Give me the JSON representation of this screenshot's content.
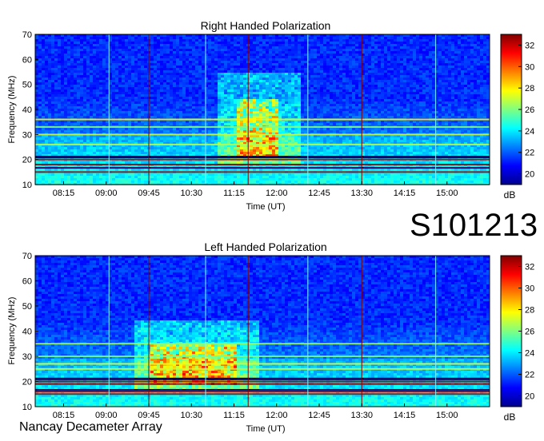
{
  "colors": {
    "background": "#ffffff",
    "colormap": [
      "#00008f",
      "#0000ff",
      "#0080ff",
      "#00ffff",
      "#80ff80",
      "#ffff00",
      "#ff8000",
      "#ff0000",
      "#800000"
    ]
  },
  "observation_id": "S101213",
  "footer": "Nancay Decameter Array",
  "chart_data": [
    {
      "type": "heatmap",
      "title": "Right Handed Polarization",
      "xlabel": "Time (UT)",
      "ylabel": "Frequency (MHz)",
      "x_ticks": [
        "08:15",
        "09:00",
        "09:45",
        "10:30",
        "11:15",
        "12:00",
        "12:45",
        "13:30",
        "14:15",
        "15:00"
      ],
      "y_ticks": [
        10,
        20,
        30,
        40,
        50,
        60,
        70
      ],
      "ylim": [
        10,
        70
      ],
      "colorbar": {
        "label": "dB",
        "ticks": [
          20,
          22,
          24,
          26,
          28,
          30,
          32
        ],
        "range": [
          19,
          33
        ]
      },
      "features": {
        "burst_time": [
          "11:15",
          "12:00"
        ],
        "burst_freq_mhz": [
          25,
          43
        ],
        "strong_bands_mhz": [
          15,
          18,
          20,
          21,
          26,
          30,
          33,
          36
        ]
      }
    },
    {
      "type": "heatmap",
      "title": "Left Handed Polarization",
      "xlabel": "Time (UT)",
      "ylabel": "Frequency (MHz)",
      "x_ticks": [
        "08:15",
        "09:00",
        "09:45",
        "10:30",
        "11:15",
        "12:00",
        "12:45",
        "13:30",
        "14:15",
        "15:00"
      ],
      "y_ticks": [
        10,
        20,
        30,
        40,
        50,
        60,
        70
      ],
      "ylim": [
        10,
        70
      ],
      "colorbar": {
        "label": "dB",
        "ticks": [
          20,
          22,
          24,
          26,
          28,
          30,
          32
        ],
        "range": [
          19,
          33
        ]
      },
      "features": {
        "burst_time": [
          "09:45",
          "11:15"
        ],
        "burst_freq_mhz": [
          22,
          33
        ],
        "strong_bands_mhz": [
          15,
          16,
          19,
          20,
          21,
          25,
          27,
          30,
          35
        ]
      }
    }
  ]
}
